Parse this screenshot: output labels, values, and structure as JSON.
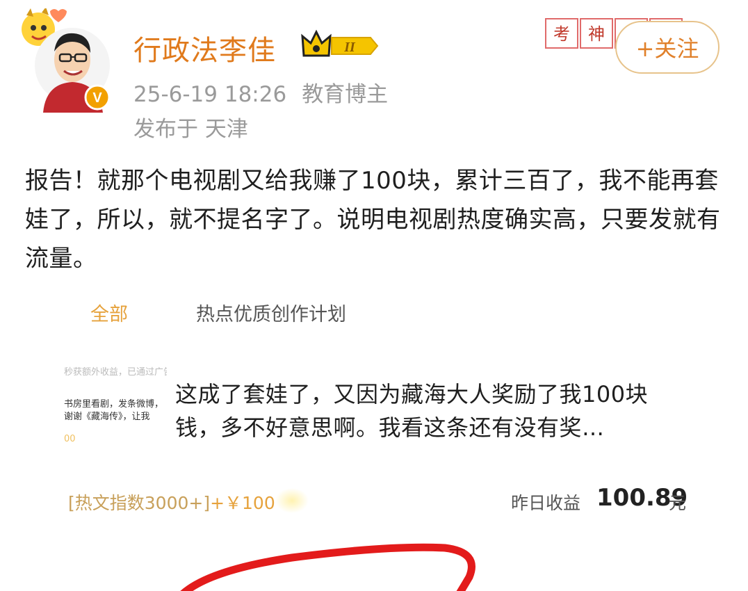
{
  "header": {
    "username": "行政法李佳",
    "badge_level": "II",
    "timestamp": "25-6-19 18:26",
    "role": "教育博主",
    "location": "发布于 天津",
    "stamp_chars": [
      "考",
      "神"
    ],
    "follow_label": "+关注"
  },
  "post": {
    "body": "报告！就那个电视剧又给我赚了100块，累计三百了，我不能再套娃了，所以，就不提名字了。说明电视剧热度确实高，只要发就有流量。"
  },
  "tabs": [
    {
      "label": "全部",
      "active": true
    },
    {
      "label": "热点优质创作计划",
      "active": false
    }
  ],
  "card": {
    "thumb_lines": [
      "秒获额外收益，已通过广告并",
      "书房里看剧，发条微博，",
      "谢谢《藏海传》，让我",
      "00"
    ],
    "text": "这成了套娃了，又因为藏海大人奖励了我100块钱，多不好意思啊。我看这条还有没有奖…"
  },
  "earnings": {
    "hot_index": "[热文指数3000+]",
    "reward": "+￥100",
    "yesterday_label": "昨日收益",
    "yesterday_value": "100.89",
    "unit": "元"
  },
  "colors": {
    "username": "#e07a1c",
    "follow_border": "#e7c38b",
    "tab_active": "#e6a23c",
    "verified": "#f2a000",
    "annotation": "#e31b1b"
  }
}
